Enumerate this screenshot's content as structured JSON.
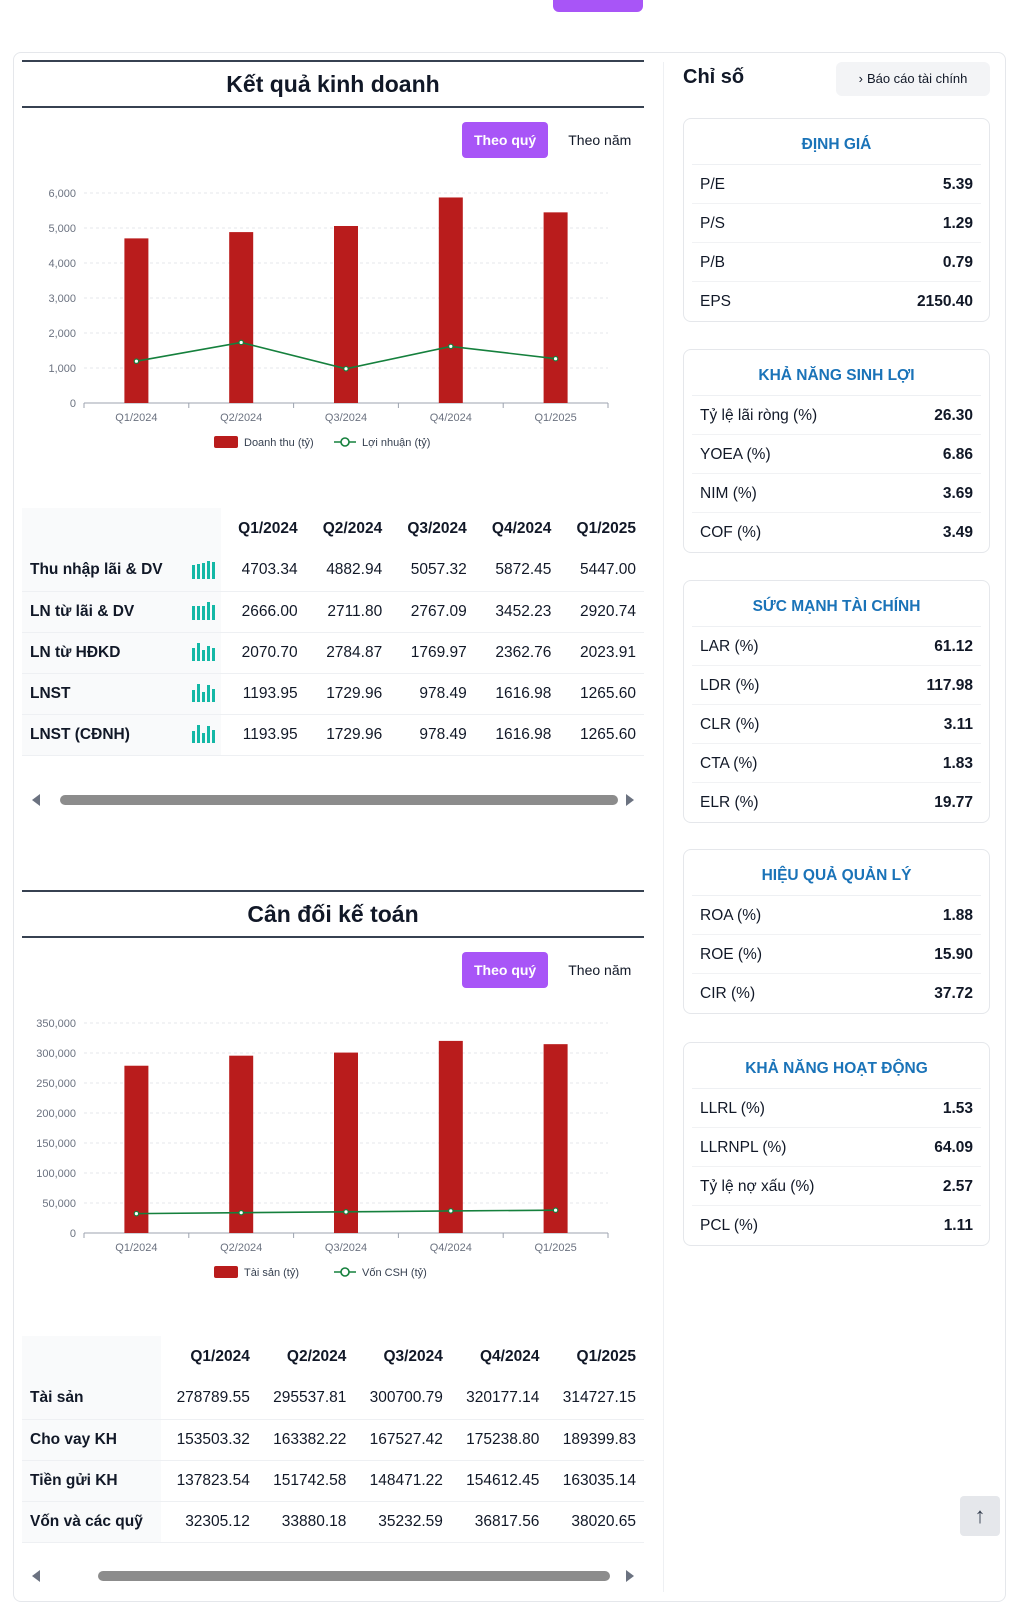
{
  "business": {
    "title": "Kết quả kinh doanh",
    "tab_quarter": "Theo quý",
    "tab_year": "Theo năm",
    "columns": [
      "Q1/2024",
      "Q2/2024",
      "Q3/2024",
      "Q4/2024",
      "Q1/2025"
    ],
    "rows": [
      {
        "label": "Thu nhập lãi & DV",
        "values": [
          "4703.34",
          "4882.94",
          "5057.32",
          "5872.45",
          "5447.00"
        ]
      },
      {
        "label": "LN từ lãi & DV",
        "values": [
          "2666.00",
          "2711.80",
          "2767.09",
          "3452.23",
          "2920.74"
        ]
      },
      {
        "label": "LN từ HĐKD",
        "values": [
          "2070.70",
          "2784.87",
          "1769.97",
          "2362.76",
          "2023.91"
        ]
      },
      {
        "label": "LNST",
        "values": [
          "1193.95",
          "1729.96",
          "978.49",
          "1616.98",
          "1265.60"
        ]
      },
      {
        "label": "LNST (CĐNH)",
        "values": [
          "1193.95",
          "1729.96",
          "978.49",
          "1616.98",
          "1265.60"
        ]
      }
    ]
  },
  "balance": {
    "title": "Cân đối kế toán",
    "tab_quarter": "Theo quý",
    "tab_year": "Theo năm",
    "columns": [
      "Q1/2024",
      "Q2/2024",
      "Q3/2024",
      "Q4/2024",
      "Q1/2025"
    ],
    "rows": [
      {
        "label": "Tài sản",
        "values": [
          "278789.55",
          "295537.81",
          "300700.79",
          "320177.14",
          "314727.15"
        ]
      },
      {
        "label": "Cho vay KH",
        "values": [
          "153503.32",
          "163382.22",
          "167527.42",
          "175238.80",
          "189399.83"
        ]
      },
      {
        "label": "Tiền gửi KH",
        "values": [
          "137823.54",
          "151742.58",
          "148471.22",
          "154612.45",
          "163035.14"
        ]
      },
      {
        "label": "Vốn và các quỹ",
        "values": [
          "32305.12",
          "33880.18",
          "35232.59",
          "36817.56",
          "38020.65"
        ]
      }
    ]
  },
  "chart_data": [
    {
      "type": "bar",
      "categories": [
        "Q1/2024",
        "Q2/2024",
        "Q3/2024",
        "Q4/2024",
        "Q1/2025"
      ],
      "series": [
        {
          "name": "Doanh thu (tỷ)",
          "kind": "bar",
          "color": "#b91c1c",
          "values": [
            4703.34,
            4882.94,
            5057.32,
            5872.45,
            5447.0
          ]
        },
        {
          "name": "Lợi nhuận (tỷ)",
          "kind": "line",
          "color": "#15803d",
          "values": [
            1193.95,
            1729.96,
            978.49,
            1616.98,
            1265.6
          ]
        }
      ],
      "yticks": [
        "0",
        "1,000",
        "2,000",
        "3,000",
        "4,000",
        "5,000",
        "6,000"
      ],
      "ylim": [
        0,
        6000
      ],
      "grid": true,
      "legend": "bottom"
    },
    {
      "type": "bar",
      "categories": [
        "Q1/2024",
        "Q2/2024",
        "Q3/2024",
        "Q4/2024",
        "Q1/2025"
      ],
      "series": [
        {
          "name": "Tài sản (tỷ)",
          "kind": "bar",
          "color": "#b91c1c",
          "values": [
            278789.55,
            295537.81,
            300700.79,
            320177.14,
            314727.15
          ]
        },
        {
          "name": "Vốn CSH (tỷ)",
          "kind": "line",
          "color": "#15803d",
          "values": [
            32305.12,
            33880.18,
            35232.59,
            36817.56,
            38020.65
          ]
        }
      ],
      "yticks": [
        "0",
        "50,000",
        "100,000",
        "150,000",
        "200,000",
        "250,000",
        "300,000",
        "350,000"
      ],
      "ylim": [
        0,
        350000
      ],
      "grid": true,
      "legend": "bottom"
    }
  ],
  "sidebar": {
    "title": "Chỉ số",
    "report_button": "Báo cáo tài chính",
    "cards": [
      {
        "title": "ĐỊNH GIÁ",
        "rows": [
          {
            "label": "P/E",
            "value": "5.39"
          },
          {
            "label": "P/S",
            "value": "1.29"
          },
          {
            "label": "P/B",
            "value": "0.79"
          },
          {
            "label": "EPS",
            "value": "2150.40"
          }
        ]
      },
      {
        "title": "KHẢ NĂNG SINH LỢI",
        "rows": [
          {
            "label": "Tỷ lệ lãi ròng (%)",
            "value": "26.30"
          },
          {
            "label": "YOEA (%)",
            "value": "6.86"
          },
          {
            "label": "NIM (%)",
            "value": "3.69"
          },
          {
            "label": "COF (%)",
            "value": "3.49"
          }
        ]
      },
      {
        "title": "SỨC MẠNH TÀI CHÍNH",
        "rows": [
          {
            "label": "LAR (%)",
            "value": "61.12"
          },
          {
            "label": "LDR (%)",
            "value": "117.98"
          },
          {
            "label": "CLR (%)",
            "value": "3.11"
          },
          {
            "label": "CTA (%)",
            "value": "1.83"
          },
          {
            "label": "ELR (%)",
            "value": "19.77"
          }
        ]
      },
      {
        "title": "HIỆU QUẢ QUẢN LÝ",
        "rows": [
          {
            "label": "ROA (%)",
            "value": "1.88"
          },
          {
            "label": "ROE (%)",
            "value": "15.90"
          },
          {
            "label": "CIR (%)",
            "value": "37.72"
          }
        ]
      },
      {
        "title": "KHẢ NĂNG HOẠT ĐỘNG",
        "rows": [
          {
            "label": "LLRL (%)",
            "value": "1.53"
          },
          {
            "label": "LLRNPL (%)",
            "value": "64.09"
          },
          {
            "label": "Tỷ lệ nợ xấu (%)",
            "value": "2.57"
          },
          {
            "label": "PCL (%)",
            "value": "1.11"
          }
        ]
      }
    ]
  },
  "scroll_top_icon": "arrow-up-icon"
}
